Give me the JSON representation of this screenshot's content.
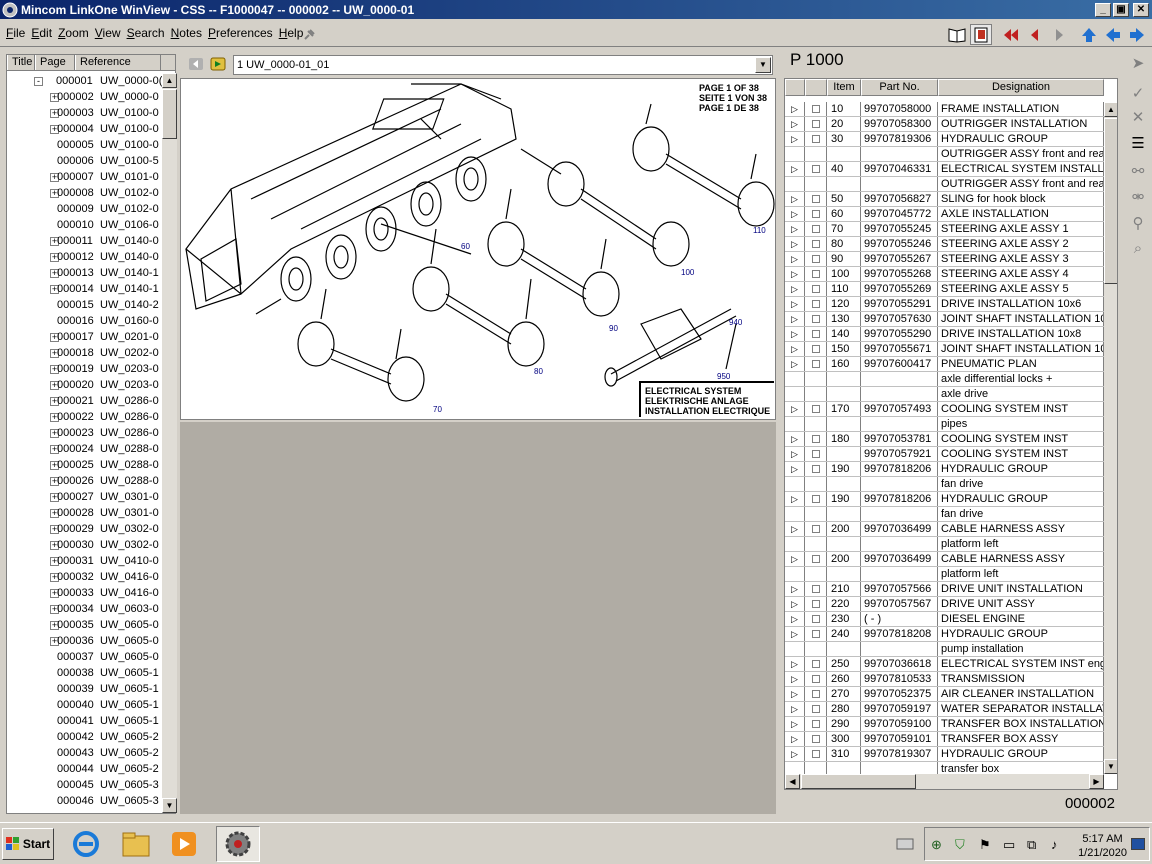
{
  "window": {
    "title": "Mincom LinkOne WinView - CSS -- F1000047 -- 000002 -- UW_0000-01",
    "min_glyph": "_",
    "max_glyph": "▣",
    "close_glyph": "✕"
  },
  "menu": [
    "File",
    "Edit",
    "Zoom",
    "View",
    "Search",
    "Notes",
    "Preferences",
    "Help"
  ],
  "tree": {
    "columns": [
      "Title",
      "Page",
      "Reference"
    ],
    "rows": [
      {
        "id": "000001",
        "ref": "UW_0000-0(",
        "exp": "-"
      },
      {
        "id": "000002",
        "ref": "UW_0000-0",
        "exp": "+"
      },
      {
        "id": "000003",
        "ref": "UW_0100-0",
        "exp": "+"
      },
      {
        "id": "000004",
        "ref": "UW_0100-0",
        "exp": "+"
      },
      {
        "id": "000005",
        "ref": "UW_0100-0",
        "exp": ""
      },
      {
        "id": "000006",
        "ref": "UW_0100-5",
        "exp": ""
      },
      {
        "id": "000007",
        "ref": "UW_0101-0",
        "exp": "+"
      },
      {
        "id": "000008",
        "ref": "UW_0102-0",
        "exp": "+"
      },
      {
        "id": "000009",
        "ref": "UW_0102-0",
        "exp": ""
      },
      {
        "id": "000010",
        "ref": "UW_0106-0",
        "exp": ""
      },
      {
        "id": "000011",
        "ref": "UW_0140-0",
        "exp": "+"
      },
      {
        "id": "000012",
        "ref": "UW_0140-0",
        "exp": "+"
      },
      {
        "id": "000013",
        "ref": "UW_0140-1",
        "exp": "+"
      },
      {
        "id": "000014",
        "ref": "UW_0140-1",
        "exp": "+"
      },
      {
        "id": "000015",
        "ref": "UW_0140-2",
        "exp": ""
      },
      {
        "id": "000016",
        "ref": "UW_0160-0",
        "exp": ""
      },
      {
        "id": "000017",
        "ref": "UW_0201-0",
        "exp": "+"
      },
      {
        "id": "000018",
        "ref": "UW_0202-0",
        "exp": "+"
      },
      {
        "id": "000019",
        "ref": "UW_0203-0",
        "exp": "+"
      },
      {
        "id": "000020",
        "ref": "UW_0203-0",
        "exp": "+"
      },
      {
        "id": "000021",
        "ref": "UW_0286-0",
        "exp": "+"
      },
      {
        "id": "000022",
        "ref": "UW_0286-0",
        "exp": "+"
      },
      {
        "id": "000023",
        "ref": "UW_0286-0",
        "exp": "+"
      },
      {
        "id": "000024",
        "ref": "UW_0288-0",
        "exp": "+"
      },
      {
        "id": "000025",
        "ref": "UW_0288-0",
        "exp": "+"
      },
      {
        "id": "000026",
        "ref": "UW_0288-0",
        "exp": "+"
      },
      {
        "id": "000027",
        "ref": "UW_0301-0",
        "exp": "+"
      },
      {
        "id": "000028",
        "ref": "UW_0301-0",
        "exp": "+"
      },
      {
        "id": "000029",
        "ref": "UW_0302-0",
        "exp": "+"
      },
      {
        "id": "000030",
        "ref": "UW_0302-0",
        "exp": "+"
      },
      {
        "id": "000031",
        "ref": "UW_0410-0",
        "exp": "+"
      },
      {
        "id": "000032",
        "ref": "UW_0416-0",
        "exp": "+"
      },
      {
        "id": "000033",
        "ref": "UW_0416-0",
        "exp": "+"
      },
      {
        "id": "000034",
        "ref": "UW_0603-0",
        "exp": "+"
      },
      {
        "id": "000035",
        "ref": "UW_0605-0",
        "exp": "+"
      },
      {
        "id": "000036",
        "ref": "UW_0605-0",
        "exp": "+"
      },
      {
        "id": "000037",
        "ref": "UW_0605-0",
        "exp": ""
      },
      {
        "id": "000038",
        "ref": "UW_0605-1",
        "exp": ""
      },
      {
        "id": "000039",
        "ref": "UW_0605-1",
        "exp": ""
      },
      {
        "id": "000040",
        "ref": "UW_0605-1",
        "exp": ""
      },
      {
        "id": "000041",
        "ref": "UW_0605-1",
        "exp": ""
      },
      {
        "id": "000042",
        "ref": "UW_0605-2",
        "exp": ""
      },
      {
        "id": "000043",
        "ref": "UW_0605-2",
        "exp": ""
      },
      {
        "id": "000044",
        "ref": "UW_0605-2",
        "exp": ""
      },
      {
        "id": "000045",
        "ref": "UW_0605-3",
        "exp": ""
      },
      {
        "id": "000046",
        "ref": "UW_0605-3",
        "exp": ""
      }
    ]
  },
  "page_selector": {
    "value": "1 UW_0000-01_01"
  },
  "drawing": {
    "page_note": [
      "PAGE 1 OF 38",
      "SEITE 1 VON 38",
      "PAGE 1 DE 38"
    ],
    "system_label": [
      "ELECTRICAL SYSTEM",
      "ELEKTRISCHE ANLAGE",
      "INSTALLATION ELECTRIQUE"
    ],
    "callouts": [
      "60",
      "110",
      "100",
      "90",
      "80",
      "70",
      "940",
      "950"
    ]
  },
  "parts": {
    "heading": "P 1000",
    "columns": [
      "Item",
      "Part No.",
      "Designation"
    ],
    "rows": [
      {
        "item": "10",
        "part": "99707058000",
        "des": "FRAME INSTALLATION",
        "arrow": true
      },
      {
        "item": "20",
        "part": "99707058300",
        "des": "OUTRIGGER INSTALLATION",
        "arrow": true
      },
      {
        "item": "30",
        "part": "99707819306",
        "des": "HYDRAULIC GROUP",
        "arrow": true
      },
      {
        "item": "",
        "part": "",
        "des": "OUTRIGGER ASSY front and rear",
        "arrow": false
      },
      {
        "item": "40",
        "part": "99707046331",
        "des": "ELECTRICAL SYSTEM INSTALLATI",
        "arrow": true
      },
      {
        "item": "",
        "part": "",
        "des": "OUTRIGGER ASSY front and rear",
        "arrow": false
      },
      {
        "item": "50",
        "part": "99707056827",
        "des": "SLING for hook block",
        "arrow": true
      },
      {
        "item": "60",
        "part": "99707045772",
        "des": "AXLE INSTALLATION",
        "arrow": true
      },
      {
        "item": "70",
        "part": "99707055245",
        "des": "STEERING AXLE ASSY 1",
        "arrow": true
      },
      {
        "item": "80",
        "part": "99707055246",
        "des": "STEERING AXLE ASSY 2",
        "arrow": true
      },
      {
        "item": "90",
        "part": "99707055267",
        "des": "STEERING AXLE ASSY 3",
        "arrow": true
      },
      {
        "item": "100",
        "part": "99707055268",
        "des": "STEERING AXLE ASSY 4",
        "arrow": true
      },
      {
        "item": "110",
        "part": "99707055269",
        "des": "STEERING AXLE ASSY 5",
        "arrow": true
      },
      {
        "item": "120",
        "part": "99707055291",
        "des": "DRIVE INSTALLATION 10x6",
        "arrow": true
      },
      {
        "item": "130",
        "part": "99707057630",
        "des": "JOINT SHAFT INSTALLATION 10x",
        "arrow": true
      },
      {
        "item": "140",
        "part": "99707055290",
        "des": "DRIVE INSTALLATION 10x8",
        "arrow": true
      },
      {
        "item": "150",
        "part": "99707055671",
        "des": "JOINT SHAFT INSTALLATION 10x",
        "arrow": true
      },
      {
        "item": "160",
        "part": "99707600417",
        "des": "PNEUMATIC PLAN",
        "arrow": true
      },
      {
        "item": "",
        "part": "",
        "des": "axle differential locks +",
        "arrow": false
      },
      {
        "item": "",
        "part": "",
        "des": "axle drive",
        "arrow": false
      },
      {
        "item": "170",
        "part": "99707057493",
        "des": "COOLING SYSTEM INST",
        "arrow": true
      },
      {
        "item": "",
        "part": "",
        "des": "pipes",
        "arrow": false
      },
      {
        "item": "180",
        "part": "99707053781",
        "des": "COOLING SYSTEM INST",
        "arrow": true
      },
      {
        "item": "",
        "part": "99707057921",
        "des": "COOLING SYSTEM INST",
        "arrow": true
      },
      {
        "item": "190",
        "part": "99707818206",
        "des": "HYDRAULIC GROUP",
        "arrow": true
      },
      {
        "item": "",
        "part": "",
        "des": "fan drive",
        "arrow": false
      },
      {
        "item": "190",
        "part": "99707818206",
        "des": "HYDRAULIC GROUP",
        "arrow": true
      },
      {
        "item": "",
        "part": "",
        "des": "fan drive",
        "arrow": false
      },
      {
        "item": "200",
        "part": "99707036499",
        "des": "CABLE HARNESS ASSY",
        "arrow": true
      },
      {
        "item": "",
        "part": "",
        "des": "platform left",
        "arrow": false
      },
      {
        "item": "200",
        "part": "99707036499",
        "des": "CABLE HARNESS ASSY",
        "arrow": true
      },
      {
        "item": "",
        "part": "",
        "des": "platform left",
        "arrow": false
      },
      {
        "item": "210",
        "part": "99707057566",
        "des": "DRIVE UNIT INSTALLATION",
        "arrow": true
      },
      {
        "item": "220",
        "part": "99707057567",
        "des": "DRIVE UNIT ASSY",
        "arrow": true
      },
      {
        "item": "230",
        "part": "(    -    )",
        "des": "DIESEL ENGINE",
        "arrow": true
      },
      {
        "item": "240",
        "part": "99707818208",
        "des": "HYDRAULIC GROUP",
        "arrow": true
      },
      {
        "item": "",
        "part": "",
        "des": "pump installation",
        "arrow": false
      },
      {
        "item": "250",
        "part": "99707036618",
        "des": "ELECTRICAL SYSTEM INST engin",
        "arrow": true
      },
      {
        "item": "260",
        "part": "99707810533",
        "des": "TRANSMISSION",
        "arrow": true
      },
      {
        "item": "270",
        "part": "99707052375",
        "des": "AIR CLEANER INSTALLATION",
        "arrow": true
      },
      {
        "item": "280",
        "part": "99707059197",
        "des": "WATER SEPARATOR INSTALLAT",
        "arrow": true
      },
      {
        "item": "290",
        "part": "99707059100",
        "des": "TRANSFER BOX INSTALLATION",
        "arrow": true
      },
      {
        "item": "300",
        "part": "99707059101",
        "des": "TRANSFER BOX ASSY",
        "arrow": true
      },
      {
        "item": "310",
        "part": "99707819307",
        "des": "HYDRAULIC GROUP",
        "arrow": true
      },
      {
        "item": "",
        "part": "",
        "des": "transfer box",
        "arrow": false
      }
    ],
    "page_number": "000002"
  },
  "taskbar": {
    "start": "Start",
    "time": "5:17 AM",
    "date": "1/21/2020"
  }
}
